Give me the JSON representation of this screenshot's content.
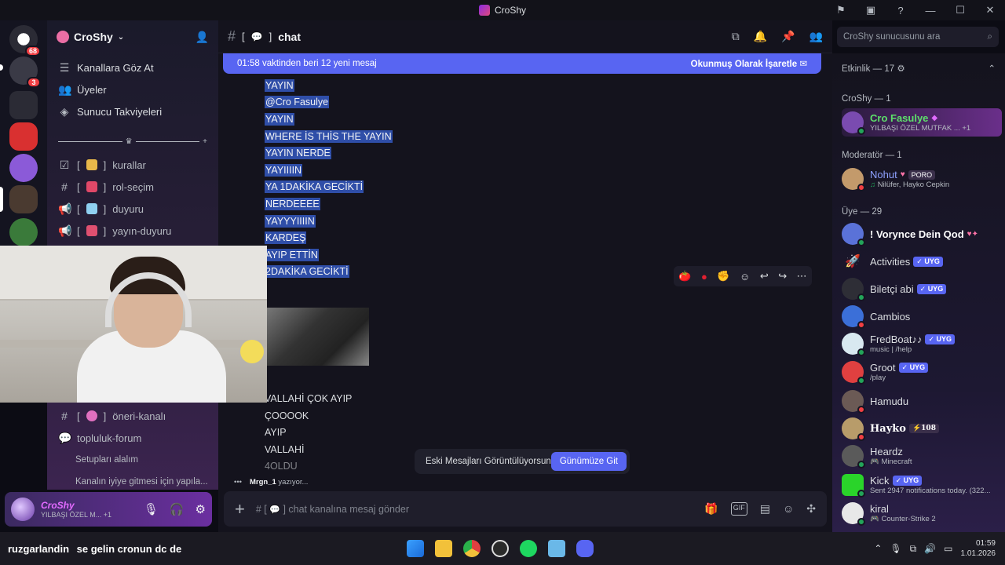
{
  "window": {
    "title": "CroShy"
  },
  "rail": {
    "badges": [
      "68",
      "3"
    ]
  },
  "server": {
    "name": "CroShy",
    "nav": [
      {
        "label": "Kanallara Göz At",
        "icon": "browse-icon"
      },
      {
        "label": "Üyeler",
        "icon": "members-icon"
      },
      {
        "label": "Sunucu Takviyeleri",
        "icon": "boost-icon"
      }
    ],
    "channels": [
      {
        "name": "kurallar",
        "icon": "rules-icon",
        "prefix": "[",
        "suffix": "]"
      },
      {
        "name": "rol-seçim",
        "icon": "hash-icon",
        "prefix": "[",
        "suffix": "]"
      },
      {
        "name": "duyuru",
        "icon": "announcement-icon",
        "prefix": "[",
        "suffix": "]"
      },
      {
        "name": "yayın-duyuru",
        "icon": "announcement-icon",
        "prefix": "[",
        "suffix": "]"
      }
    ],
    "lower_channels": [
      {
        "name": "öneri-kanalı",
        "icon": "hash-icon",
        "prefix": "[",
        "suffix": "]"
      },
      {
        "name": "topluluk-forum",
        "icon": "forum-icon"
      }
    ],
    "threads": [
      "Setupları alalım",
      "Kanalın iyiye gitmesi için yapıla..."
    ]
  },
  "user_panel": {
    "username": "CroShy",
    "status": "YILBAŞI ÖZEL M...",
    "extra": "+1"
  },
  "chat": {
    "channel_name": "chat",
    "bracket_open": "[",
    "bracket_close": "]",
    "new_messages": "01:58 vaktinden beri 12 yeni mesaj",
    "mark_read": "Okunmuş Olarak İşaretle",
    "messages_selected": [
      "YAYIN",
      "@Cro Fasulye",
      "YAYIN",
      "WHERE İS THİS THE YAYIN",
      "YAYIN NERDE",
      "YAYIIIIN",
      "YA 1DAKİKA GECİKTİ",
      "NERDEEEE",
      "YAYYYIIIIN",
      "KARDEŞ",
      "AYIP ETTİN",
      "2DAKİKA GECİKTİ"
    ],
    "messages_after": [
      "VALLAHİ ÇOK AYIP",
      "ÇOOOOK",
      "AYIP",
      "VALLAHİ",
      "4OLDU"
    ],
    "old_messages_banner": "Eski Mesajları Görüntülüyorsun",
    "jump_present": "Günümüze Git",
    "typing_user": "Mrgn_1",
    "typing_text": "yazıyor...",
    "composer_placeholder": "chat kanalına mesaj gönder",
    "composer_prefix": "# [",
    "composer_suffix": "]"
  },
  "search": {
    "placeholder": "CroShy sunucusunu ara"
  },
  "members": {
    "activity_header": "Etkinlik — 17",
    "sections": [
      {
        "title": "CroShy — 1",
        "items": [
          {
            "name": "Cro Fasulye",
            "sub": "YILBAŞI ÖZEL MUTFAK ...",
            "extra": "+1",
            "color": "#5de06a",
            "av": "#7a4bb0"
          }
        ]
      },
      {
        "title": "Moderatör — 1",
        "items": [
          {
            "name": "Nohut",
            "tag": "PORO",
            "sub": "Nilüfer, Hayko Cepkin",
            "color": "#8ea1ff",
            "av": "#c39a6b"
          }
        ]
      },
      {
        "title": "Üye — 29",
        "items": [
          {
            "name": "! Vorynce Dein Qod",
            "sub": "",
            "color": "#ffffff",
            "av": "#5a72d8"
          },
          {
            "name": "Activities",
            "uyg": "UYG",
            "sub": "",
            "color": "#dbdee1",
            "av": "#e86b6b"
          },
          {
            "name": "Biletçi abi",
            "uyg": "UYG",
            "sub": "",
            "color": "#dbdee1",
            "av": "#2e2e36"
          },
          {
            "name": "Cambios",
            "sub": "",
            "color": "#dbdee1",
            "av": "#3b6fd8"
          },
          {
            "name": "FredBoat♪♪",
            "uyg": "UYG",
            "sub": "music | /help",
            "color": "#dbdee1",
            "av": "#d8e8f0"
          },
          {
            "name": "Groot",
            "uyg": "UYG",
            "sub": "/play",
            "color": "#dbdee1",
            "av": "#e04040"
          },
          {
            "name": "Hamudu",
            "sub": "",
            "color": "#dbdee1",
            "av": "#6b5a55"
          },
          {
            "name": "Hayko",
            "tag": "108",
            "sub": "",
            "color": "#ffffff",
            "av": "#b89c6a"
          },
          {
            "name": "Heardz",
            "sub": "Minecraft",
            "color": "#dbdee1",
            "av": "#5a5a5a"
          },
          {
            "name": "Kick",
            "uyg": "UYG",
            "sub": "Sent 2947 notifications today. (322...",
            "color": "#dbdee1",
            "av": "#2ad42a"
          },
          {
            "name": "kiral",
            "sub": "Counter-Strike 2",
            "color": "#dbdee1",
            "av": "#e8e8e8"
          }
        ]
      }
    ]
  },
  "taskbar": {
    "chat_user": "ruzgarlandin",
    "chat_text": "se gelin cronun dc de",
    "time": "01:59",
    "date": "1.01.2026"
  }
}
